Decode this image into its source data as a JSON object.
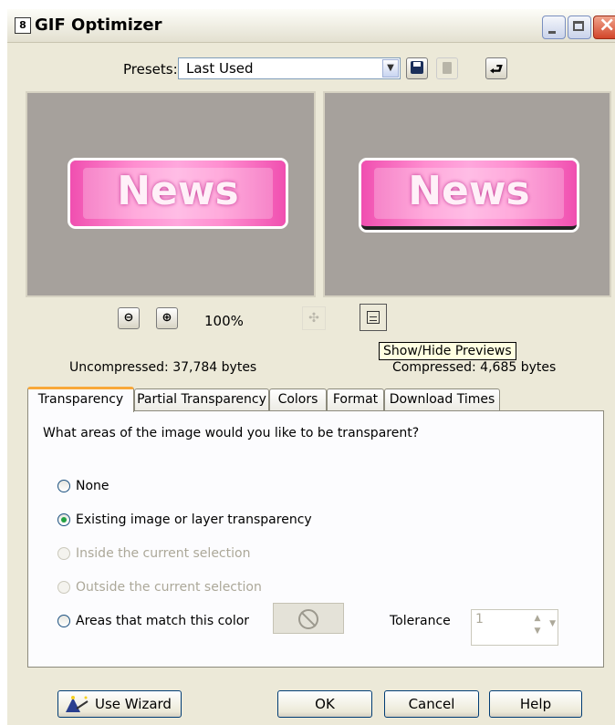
{
  "window": {
    "title": "GIF Optimizer",
    "app_icon": "8"
  },
  "presets": {
    "label": "Presets:",
    "value": "Last Used"
  },
  "preview": {
    "text_original": "News",
    "text_optimized": "News"
  },
  "zoom": {
    "level": "100%",
    "zoom_out_glyph": "🔍−",
    "zoom_in_glyph": "🔍+"
  },
  "tooltip": "Show/Hide Previews",
  "sizes": {
    "uncompressed": "Uncompressed:  37,784 bytes",
    "compressed": "Compressed: 4,685 bytes"
  },
  "tabs": [
    {
      "label": "Transparency",
      "active": true
    },
    {
      "label": "Partial Transparency",
      "active": false
    },
    {
      "label": "Colors",
      "active": false
    },
    {
      "label": "Format",
      "active": false
    },
    {
      "label": "Download Times",
      "active": false
    }
  ],
  "transparency": {
    "question": "What areas of the image would you like to be transparent?",
    "options": [
      {
        "label": "None",
        "checked": false,
        "enabled": true
      },
      {
        "label": "Existing image or layer transparency",
        "checked": true,
        "enabled": true
      },
      {
        "label": "Inside the current selection",
        "checked": false,
        "enabled": false
      },
      {
        "label": "Outside the current selection",
        "checked": false,
        "enabled": false
      },
      {
        "label": "Areas that match this color",
        "checked": false,
        "enabled": true
      }
    ],
    "tolerance_label": "Tolerance",
    "tolerance_value": "1"
  },
  "buttons": {
    "use_wizard": "Use Wizard",
    "ok": "OK",
    "cancel": "Cancel",
    "help": "Help"
  },
  "colors": {
    "accent_tab": "#f8a83a",
    "badge_pink": "#f04fb0",
    "dialog_bg": "#ece9d8"
  }
}
